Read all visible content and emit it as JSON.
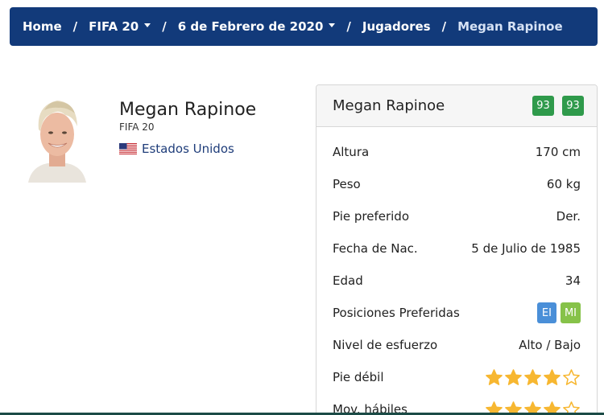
{
  "breadcrumb": {
    "home": "Home",
    "game": "FIFA 20",
    "date": "6 de Febrero de 2020",
    "section": "Jugadores",
    "current": "Megan Rapinoe",
    "separator": "/"
  },
  "player": {
    "name": "Megan Rapinoe",
    "game": "FIFA 20",
    "nationality": "Estados Unidos"
  },
  "card": {
    "title": "Megan Rapinoe",
    "overall": "93",
    "potential": "93",
    "rows": {
      "height": {
        "label": "Altura",
        "value": "170 cm"
      },
      "weight": {
        "label": "Peso",
        "value": "60 kg"
      },
      "foot": {
        "label": "Pie preferido",
        "value": "Der."
      },
      "birth": {
        "label": "Fecha de Nac.",
        "value": "5 de Julio de 1985"
      },
      "age": {
        "label": "Edad",
        "value": "34"
      },
      "positions": {
        "label": "Posiciones Preferidas",
        "values": [
          "EI",
          "MI"
        ]
      },
      "workrate": {
        "label": "Nivel de esfuerzo",
        "value": "Alto / Bajo"
      },
      "weakfoot": {
        "label": "Pie débil",
        "stars": 4,
        "max": 5
      },
      "skills": {
        "label": "Mov. hábiles",
        "stars": 4,
        "max": 5
      }
    }
  },
  "colors": {
    "navbar": "#123a7a",
    "rating": "#2f9a4b",
    "pos_ei": "#4a8fd8",
    "pos_mi": "#86c249",
    "star": "#f7b731"
  },
  "icons": {
    "flag": "us-flag-icon",
    "star_filled": "star-filled-icon",
    "star_empty": "star-outline-icon",
    "caret": "caret-down-icon"
  }
}
